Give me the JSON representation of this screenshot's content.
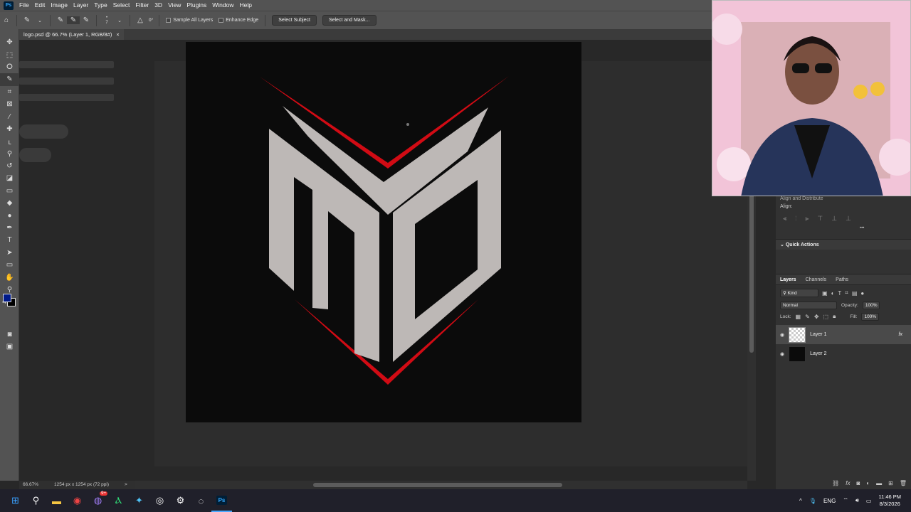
{
  "menubar": {
    "logo": "Ps",
    "items": [
      "File",
      "Edit",
      "Image",
      "Layer",
      "Type",
      "Select",
      "Filter",
      "3D",
      "View",
      "Plugins",
      "Window",
      "Help"
    ]
  },
  "options": {
    "angle": "0°",
    "brush_size": "7",
    "sample_all_layers": "Sample All Layers",
    "enhance_edge": "Enhance Edge",
    "select_subject": "Select Subject",
    "select_and_mask": "Select and Mask..."
  },
  "document": {
    "tab_title": "logo.psd @ 66.7% (Layer 1, RGB/8#)",
    "close": "×",
    "zoom": "66.67%",
    "dimensions": "1254 px x 1254 px (72 ppi)",
    "status_arrow": ">"
  },
  "panels": {
    "align_title": "Align and Distribute",
    "align_label": "Align:",
    "quick_actions": "Quick Actions",
    "more": "•••",
    "tabs": [
      "Layers",
      "Channels",
      "Paths"
    ],
    "kind": "Kind",
    "blend_mode": "Normal",
    "opacity_label": "Opacity:",
    "opacity_value": "100%",
    "lock_label": "Lock:",
    "fill_label": "Fill:",
    "fill_value": "100%",
    "fx": "fx",
    "layers": [
      {
        "name": "Layer 1",
        "selected": true
      },
      {
        "name": "Layer 2",
        "selected": false
      }
    ]
  },
  "taskbar": {
    "language": "ENG",
    "time": "11:46 PM",
    "date": "8/3/2026",
    "chevron": "^",
    "messenger_badge": "9+"
  },
  "colors": {
    "foreground": "#001a8a",
    "background": "#000000",
    "logo_red": "#d10b14",
    "logo_gray": "#bdb8b6"
  }
}
